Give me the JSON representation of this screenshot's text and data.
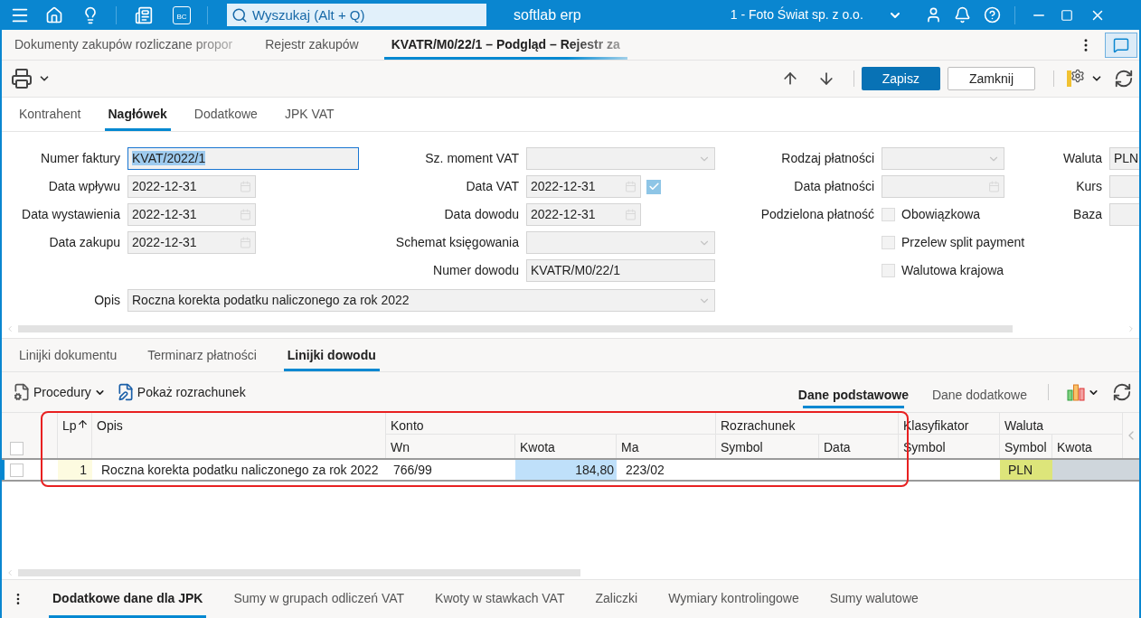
{
  "topbar": {
    "bc_label": "BC",
    "search_placeholder": "Wyszukaj (Alt + Q)",
    "product": "softlab erp",
    "company": "1 - Foto Świat sp. z o.o."
  },
  "document_tabs": [
    {
      "label": "Dokumenty zakupów rozliczane propor",
      "selected": false,
      "faded": true
    },
    {
      "label": "Rejestr zakupów",
      "selected": false,
      "faded": false
    },
    {
      "label": "KVATR/M0/22/1 – Podgląd – Rejestr za",
      "selected": true,
      "faded": true
    }
  ],
  "toolbar": {
    "buttons": [
      {
        "label": "Zapisz",
        "kind": "primary"
      },
      {
        "label": "Zamknij",
        "kind": "secondary"
      }
    ]
  },
  "form_tabs": [
    {
      "label": "Kontrahent",
      "selected": false
    },
    {
      "label": "Nagłówek",
      "selected": true
    },
    {
      "label": "Dodatkowe",
      "selected": false
    },
    {
      "label": "JPK VAT",
      "selected": false
    }
  ],
  "form": {
    "columns": [
      [
        {
          "label": "Numer faktury",
          "kind": "text",
          "value": "KVAT/2022/1",
          "focused": true
        },
        {
          "label": "Data wpływu",
          "kind": "date",
          "value": "2022-12-31",
          "focused": false
        },
        {
          "label": "Data wystawienia",
          "kind": "date",
          "value": "2022-12-31",
          "focused": false
        },
        {
          "label": "Data zakupu",
          "kind": "date",
          "value": "2022-12-31",
          "focused": false
        }
      ],
      [
        {
          "label": "Sz. moment VAT",
          "kind": "select",
          "focused": false
        },
        {
          "label": "Data VAT",
          "kind": "date_check",
          "value": "2022-12-31",
          "checked": true,
          "focused": false
        },
        {
          "label": "Data dowodu",
          "kind": "date",
          "value": "2022-12-31",
          "focused": false
        },
        {
          "label": "Schemat księgowania",
          "kind": "select",
          "focused": false
        },
        {
          "label": "Numer dowodu",
          "kind": "text",
          "value": "KVATR/M0/22/1",
          "focused": false
        }
      ],
      [
        {
          "label": "Rodzaj płatności",
          "kind": "select",
          "focused": false
        },
        {
          "label": "Data płatności",
          "kind": "date",
          "focused": false
        },
        {
          "label": "Podzielona płatność",
          "kind": "checkbox",
          "option": "Obowiązkowa",
          "checked": false
        },
        {
          "kind": "checkbox",
          "option": "Przelew split payment",
          "checked": false
        },
        {
          "kind": "checkbox",
          "option": "Walutowa krajowa",
          "checked": false
        }
      ],
      [
        {
          "label": "Waluta",
          "kind": "text",
          "value": "PLN",
          "focused": false
        },
        {
          "label": "Kurs",
          "kind": "text",
          "focused": false
        },
        {
          "label": "Baza",
          "kind": "text",
          "focused": false
        }
      ]
    ],
    "opis": {
      "label": "Opis",
      "kind": "select",
      "value": "Roczna korekta podatku naliczonego za rok 2022"
    }
  },
  "section_tabs": [
    {
      "label": "Linijki dokumentu",
      "selected": false
    },
    {
      "label": "Terminarz płatności",
      "selected": false
    },
    {
      "label": "Linijki dowodu",
      "selected": true
    }
  ],
  "grid_toolbar": {
    "actions": [
      {
        "label": "Procedury",
        "kind": "menu"
      },
      {
        "label": "Pokaż rozrachunek",
        "kind": "button"
      }
    ],
    "views": [
      {
        "label": "Dane podstawowe",
        "selected": true
      },
      {
        "label": "Dane dodatkowe",
        "selected": false
      }
    ]
  },
  "table": {
    "header_checked": false,
    "head": [
      {
        "label": "Lp",
        "sorted": true
      },
      {
        "label": "Opis",
        "sorted": false
      }
    ],
    "groups": [
      {
        "label": "Konto",
        "columns": [
          "Wn",
          "Kwota",
          "Ma"
        ]
      },
      {
        "label": "Rozrachunek",
        "columns": [
          "Symbol",
          "Data"
        ]
      },
      {
        "label": "Klasyfikator",
        "columns": [
          "Symbol"
        ]
      },
      {
        "label": "Waluta",
        "columns": [
          "Symbol",
          "Kwota"
        ]
      }
    ],
    "rows": [
      {
        "checked": false,
        "lp": "1",
        "opis": "Roczna korekta podatku naliczonego za rok 2022",
        "wn": "766/99",
        "kwota": "184,80",
        "ma": "223/02",
        "waluta_symbol": "PLN"
      }
    ]
  },
  "bottom_tabs": [
    {
      "label": "Dodatkowe dane dla JPK",
      "selected": true
    },
    {
      "label": "Sumy w grupach odliczeń VAT",
      "selected": false
    },
    {
      "label": "Kwoty w stawkach VAT",
      "selected": false
    },
    {
      "label": "Zaliczki",
      "selected": false
    },
    {
      "label": "Wymiary kontrolingowe",
      "selected": false
    },
    {
      "label": "Sumy walutowe",
      "selected": false
    }
  ]
}
